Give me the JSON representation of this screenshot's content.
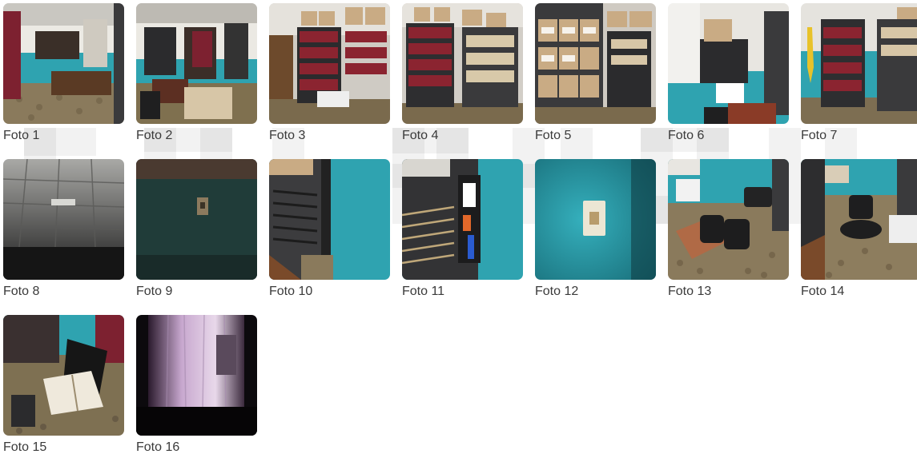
{
  "gallery": {
    "photos": [
      {
        "caption": "Foto 1",
        "scene": "office-overview"
      },
      {
        "caption": "Foto 2",
        "scene": "office-desk-corner"
      },
      {
        "caption": "Foto 3",
        "scene": "shelves-red-binders"
      },
      {
        "caption": "Foto 4",
        "scene": "shelves-boxes-binders"
      },
      {
        "caption": "Foto 5",
        "scene": "shelves-cardboard-boxes"
      },
      {
        "caption": "Foto 6",
        "scene": "window-printer"
      },
      {
        "caption": "Foto 7",
        "scene": "shelves-yellow-cable"
      },
      {
        "caption": "Foto 8",
        "scene": "ceiling-tiles"
      },
      {
        "caption": "Foto 9",
        "scene": "dark-wall-switch"
      },
      {
        "caption": "Foto 10",
        "scene": "rack-blue-wall"
      },
      {
        "caption": "Foto 11",
        "scene": "network-cabinet"
      },
      {
        "caption": "Foto 12",
        "scene": "wall-socket-blue"
      },
      {
        "caption": "Foto 13",
        "scene": "chairs-tiled-floor"
      },
      {
        "caption": "Foto 14",
        "scene": "chair-corner-floor"
      },
      {
        "caption": "Foto 15",
        "scene": "monitor-open-book"
      },
      {
        "caption": "Foto 16",
        "scene": "curtain-window"
      }
    ]
  },
  "colors": {
    "wall_blue": "#2fa3b0",
    "wall_white": "#e9e7e2",
    "floor_tile": "#8a7a5c",
    "binder_red": "#8b2430",
    "box_brown": "#c9ab84",
    "shelf_dark": "#2b2b2d",
    "caption_text": "#3a3a3a"
  }
}
